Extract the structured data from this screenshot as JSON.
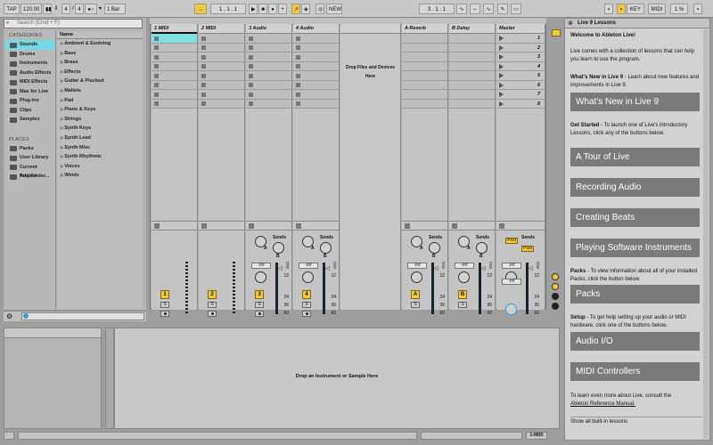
{
  "toolbar": {
    "tap": "TAP",
    "tempo": "120.00",
    "sig_num": "4",
    "sig_slash": "/",
    "sig_den": "4",
    "loop_len": "1 Bar",
    "position": "1 .   1 .   1",
    "new": "NEW",
    "loop_start": "3 .   1 .   1",
    "key": "KEY",
    "midi": "MIDI",
    "cpu": "1 %"
  },
  "browser": {
    "search_placeholder": "Search (Cmd + F)",
    "categories_header": "CATEGORIES",
    "categories": [
      "Sounds",
      "Drums",
      "Instruments",
      "Audio Effects",
      "MIDI Effects",
      "Max for Live",
      "Plug-ins",
      "Clips",
      "Samples"
    ],
    "places_header": "PLACES",
    "places": [
      "Packs",
      "User Library",
      "Current Project",
      "Add Folder..."
    ],
    "name_header": "Name",
    "items": [
      "Ambient & Evolving",
      "Bass",
      "Brass",
      "Effects",
      "Guitar & Plucked",
      "Mallets",
      "Pad",
      "Piano & Keys",
      "Strings",
      "Synth Keys",
      "Synth Lead",
      "Synth Misc",
      "Synth Rhythmic",
      "Voices",
      "Winds"
    ]
  },
  "session": {
    "tracks": [
      {
        "name": "1 MIDI",
        "number": "1"
      },
      {
        "name": "2 MIDI",
        "number": "2"
      },
      {
        "name": "3 Audio",
        "number": "3"
      },
      {
        "name": "4 Audio",
        "number": "4"
      }
    ],
    "returns": [
      {
        "name": "A Reverb",
        "letter": "A"
      },
      {
        "name": "B Delay",
        "letter": "B"
      }
    ],
    "master": "Master",
    "scenes": [
      "1",
      "2",
      "3",
      "4",
      "5",
      "6",
      "7",
      "8"
    ],
    "drop_text_1": "Drop Files and Devices",
    "drop_text_2": "Here",
    "sends_label": "Sends",
    "inf": "-Inf",
    "db_scale": [
      "0",
      "6",
      "12",
      "24",
      "36",
      "60"
    ],
    "s_label": "S",
    "knob_a": "A",
    "knob_b": "B",
    "post": "Post"
  },
  "detail": {
    "drop_instrument": "Drop an Instrument or Sample Here",
    "track_label": "1-MIDI"
  },
  "lessons": {
    "title": "Live 9 Lessons",
    "welcome": "Welcome to Ableton Live!",
    "intro": "Live comes with a collection of lessons that can help you learn to use the program.",
    "whats_new_text_bold": "What's New in Live 9",
    "whats_new_text": " - Learn about new features and improvements in Live 9.",
    "btn_whats_new": "What's New in Live 9",
    "get_started_bold": "Get Started",
    "get_started_text": " - To launch one of Live's introductory Lessons, click any of the buttons below.",
    "btn_tour": "A Tour of Live",
    "btn_recording": "Recording Audio",
    "btn_beats": "Creating Beats",
    "btn_playing": "Playing Software Instruments",
    "packs_bold": "Packs",
    "packs_text": " - To view information about all of your installed Packs, click the button below.",
    "btn_packs": "Packs",
    "setup_bold": "Setup",
    "setup_text": " - To get help setting up your audio or MIDI hardware, click one of the buttons below.",
    "btn_audio_io": "Audio I/O",
    "btn_midi": "MIDI Controllers",
    "reference_text": "To learn even more about Live, consult the",
    "reference_link": "Ableton Reference Manual.",
    "show_all": "Show all built-in lessons"
  }
}
